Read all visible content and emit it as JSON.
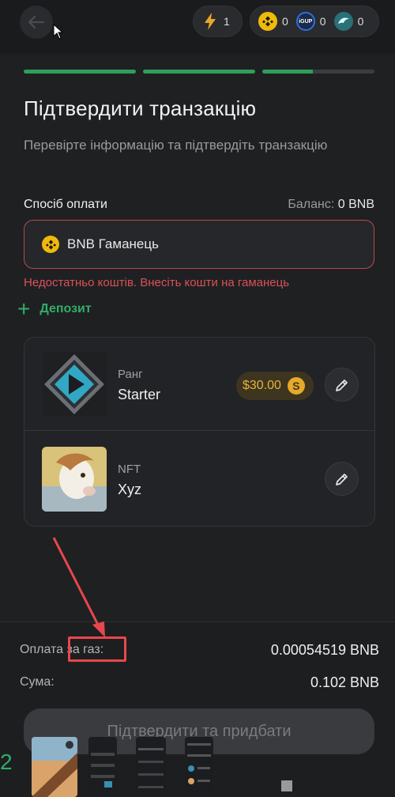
{
  "header": {
    "energy_count": "1",
    "coins": [
      {
        "icon": "bnb-coin-icon",
        "count": "0",
        "color": "#f0b90b"
      },
      {
        "icon": "igup-coin-icon",
        "count": "0",
        "color": "#2f6fd8"
      },
      {
        "icon": "dolphin-coin-icon",
        "count": "0",
        "color": "#3ab3a0"
      }
    ]
  },
  "progress": {
    "segments": [
      1,
      1,
      0.45
    ]
  },
  "page": {
    "title": "Підтвердити транзакцію",
    "subtitle": "Перевірте інформацію та підтвердіть транзакцію"
  },
  "payment": {
    "label": "Спосіб оплати",
    "balance_label": "Баланс:",
    "balance_value": "0 BNB",
    "wallet_name": "BNB Гаманець",
    "error": "Недостатньо коштів. Внесіть кошти на гаманець",
    "deposit_label": "Депозит"
  },
  "items": [
    {
      "kind": "Ранг",
      "value": "Starter",
      "price": "$30.00"
    },
    {
      "kind": "NFT",
      "value": "Xyz"
    }
  ],
  "summary": {
    "gas_label": "Оплата за газ:",
    "gas_value": "0.00054519 BNB",
    "sum_label": "Сума:",
    "sum_value": "0.102 BNB",
    "confirm_label": "Підтвердити та придбати"
  },
  "taskbar": {
    "label": "2"
  },
  "colors": {
    "accent": "#2fae69",
    "error": "#d9515a",
    "annotation": "#e8474c",
    "gold": "#e7b339"
  }
}
